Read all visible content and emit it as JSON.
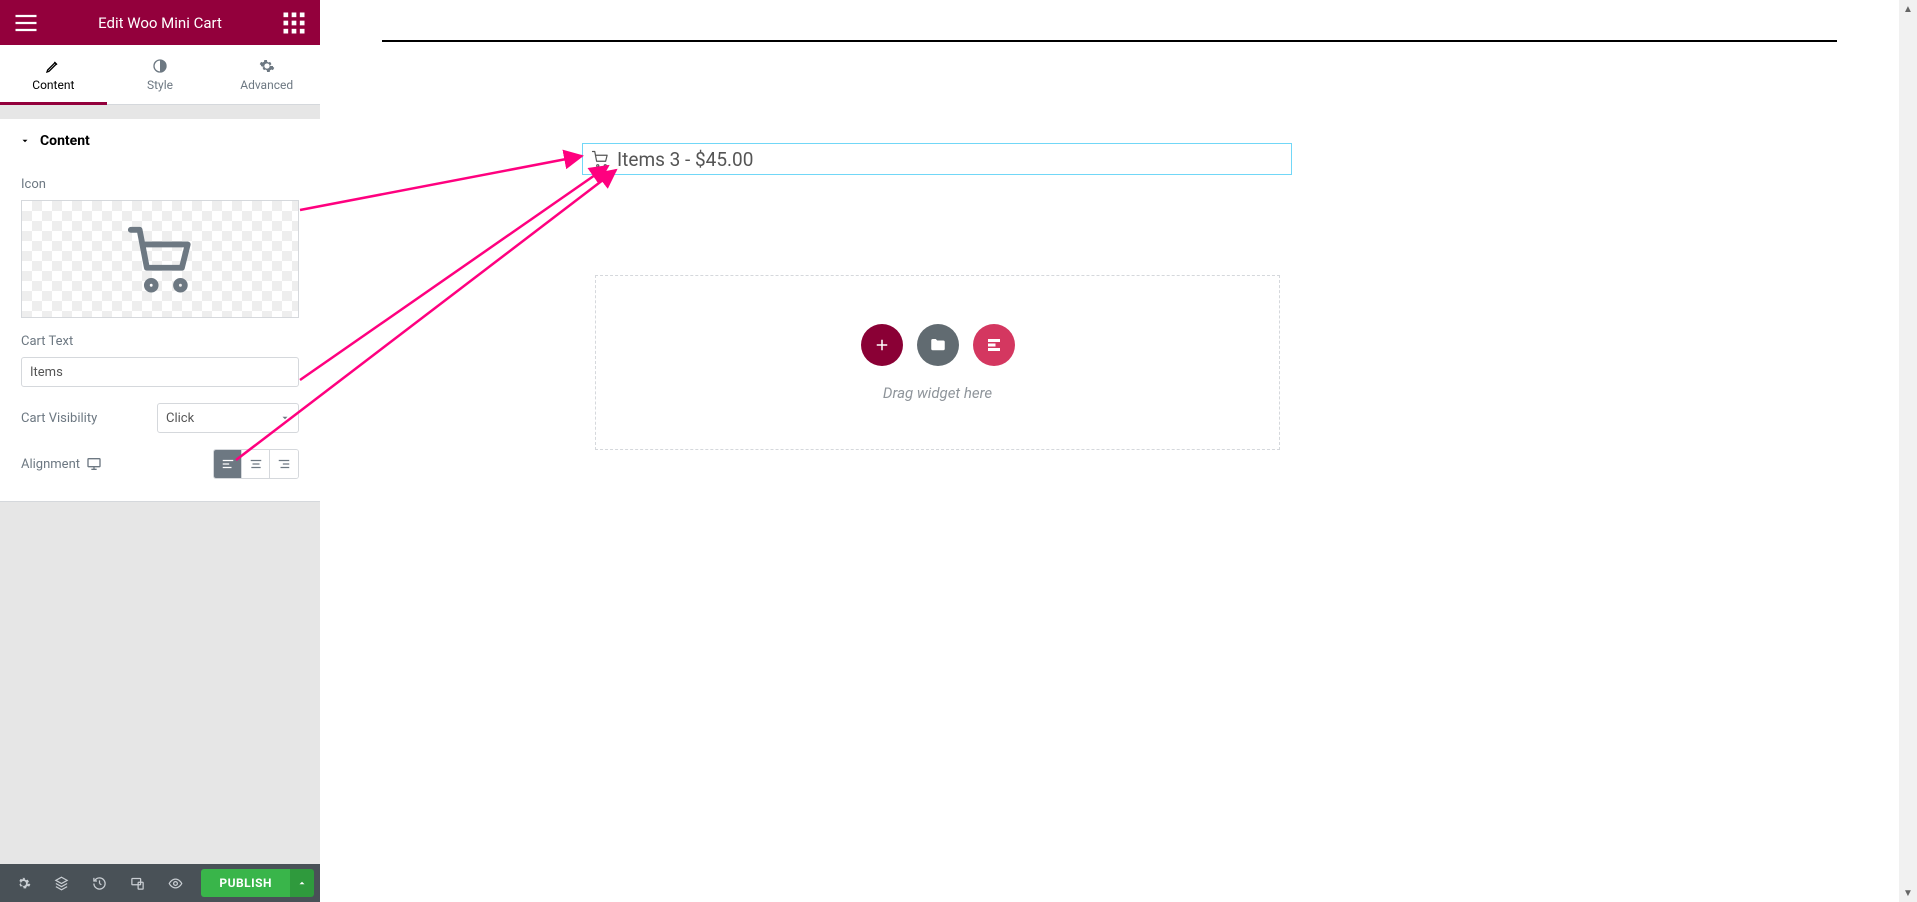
{
  "header": {
    "title": "Edit Woo Mini Cart"
  },
  "tabs": {
    "content": "Content",
    "style": "Style",
    "advanced": "Advanced"
  },
  "section": {
    "title": "Content",
    "icon_label": "Icon",
    "cart_text_label": "Cart Text",
    "cart_text_value": "Items",
    "cart_visibility_label": "Cart Visibility",
    "cart_visibility_value": "Click",
    "alignment_label": "Alignment"
  },
  "footer": {
    "publish": "PUBLISH"
  },
  "preview": {
    "cart_text": "Items 3 - $45.00",
    "drop_text": "Drag widget here"
  }
}
